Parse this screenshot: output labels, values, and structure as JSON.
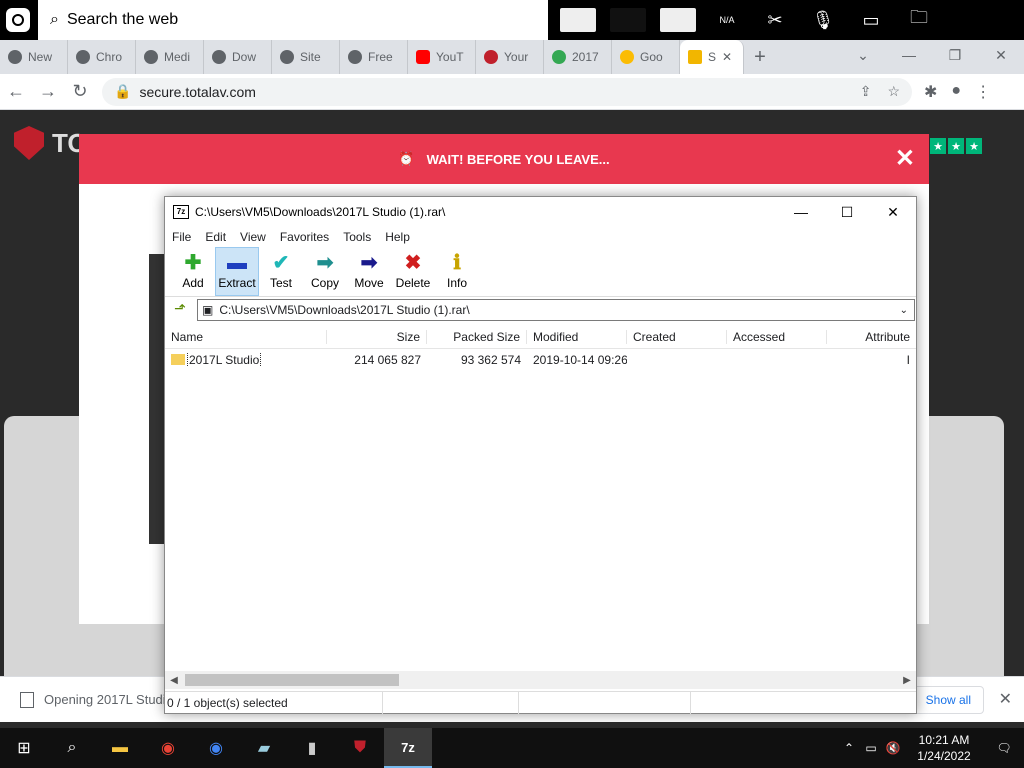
{
  "topbar": {
    "search_placeholder": "Search the web",
    "indicator_na": "N/A"
  },
  "browser": {
    "tabs": [
      {
        "label": "New"
      },
      {
        "label": "Chro"
      },
      {
        "label": "Medi"
      },
      {
        "label": "Dow"
      },
      {
        "label": "Site"
      },
      {
        "label": "Free"
      },
      {
        "label": "YouT"
      },
      {
        "label": "Your"
      },
      {
        "label": "2017"
      },
      {
        "label": "Goo"
      },
      {
        "label": "S"
      }
    ],
    "url": "secure.totalav.com"
  },
  "page": {
    "logo_text": "TO",
    "modal_title": "WAIT! BEFORE YOU LEAVE...",
    "close_glyph": "✕"
  },
  "sevenzip": {
    "title": "C:\\Users\\VM5\\Downloads\\2017L Studio (1).rar\\",
    "menu": [
      "File",
      "Edit",
      "View",
      "Favorites",
      "Tools",
      "Help"
    ],
    "toolbar": [
      {
        "label": "Add",
        "glyph": "✚",
        "color": "#2ea82e"
      },
      {
        "label": "Extract",
        "glyph": "▬",
        "color": "#1f3fbf"
      },
      {
        "label": "Test",
        "glyph": "✔",
        "color": "#1fb7b7"
      },
      {
        "label": "Copy",
        "glyph": "➡",
        "color": "#1f8f8f"
      },
      {
        "label": "Move",
        "glyph": "➡",
        "color": "#1a1a8c"
      },
      {
        "label": "Delete",
        "glyph": "✖",
        "color": "#d01f1f"
      },
      {
        "label": "Info",
        "glyph": "ℹ",
        "color": "#c8a400"
      }
    ],
    "path": "C:\\Users\\VM5\\Downloads\\2017L Studio (1).rar\\",
    "columns": [
      "Name",
      "Size",
      "Packed Size",
      "Modified",
      "Created",
      "Accessed",
      "Attribute"
    ],
    "rows": [
      {
        "name": "2017L Studio",
        "size": "214 065 827",
        "packed": "93 362 574",
        "modified": "2019-10-14 09:26",
        "created": "",
        "accessed": "",
        "attr": "I"
      }
    ],
    "status": "0 / 1 object(s) selected"
  },
  "downloads": {
    "item": "Opening 2017L Studi",
    "show_all": "Show all"
  },
  "taskbar": {
    "time": "10:21 AM",
    "date": "1/24/2022",
    "app_7z": "7z"
  }
}
